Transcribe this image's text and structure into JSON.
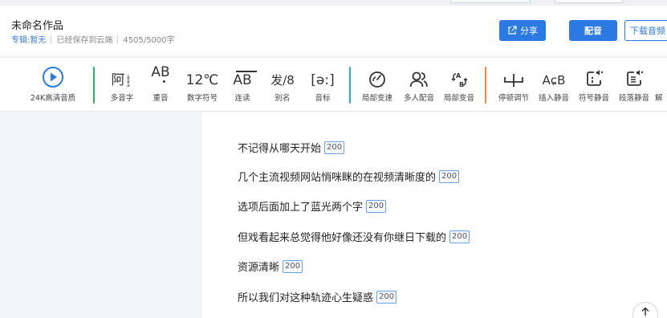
{
  "header": {
    "title": "未命名作品",
    "album_label": "专辑:",
    "album_value": "暂无",
    "saved_status": "已经保存到云端",
    "char_count": "4505/5000字",
    "share_label": "分享",
    "dub_label": "配音",
    "download_label": "下载音频"
  },
  "toolbar": {
    "quality": "24K高清音质",
    "polyphone_glyph": "阿",
    "polyphone": "多音字",
    "stress_glyph": "AB",
    "stress": "重音",
    "number_glyph": "12℃",
    "number": "数字符号",
    "liaison_glyph": "AB",
    "liaison": "连读",
    "alias_glyph": "发/8",
    "alias": "别名",
    "phonetic_glyph": "[ə:]",
    "phonetic": "音标",
    "local_speed": "局部变速",
    "multi_voice": "多人配音",
    "local_voice": "局部变音",
    "pause": "停顿调节",
    "insert_silence_glyph": "AɕB",
    "insert_silence": "插入静音",
    "symbol_silence": "符号静音",
    "paragraph_silence": "段落静音",
    "more": "解"
  },
  "lines": [
    {
      "text": "不记得从哪天开始",
      "tag": "200"
    },
    {
      "text": "几个主流视频网站悄咪眯的在视频清晰度的",
      "tag": "200"
    },
    {
      "text": "选项后面加上了蓝光两个字",
      "tag": "200"
    },
    {
      "text": "但戏看起来总觉得他好像还没有你继日下载的",
      "tag": "200"
    },
    {
      "text": "资源清晰",
      "tag": "200"
    },
    {
      "text": "所以我们对这种轨迹心生疑惑",
      "tag": "200"
    }
  ],
  "colors": {
    "accent": "#2b7ae4",
    "divider_green": "#2fb36b",
    "divider_cyan": "#1fb5d6",
    "divider_orange": "#f08a3c"
  }
}
